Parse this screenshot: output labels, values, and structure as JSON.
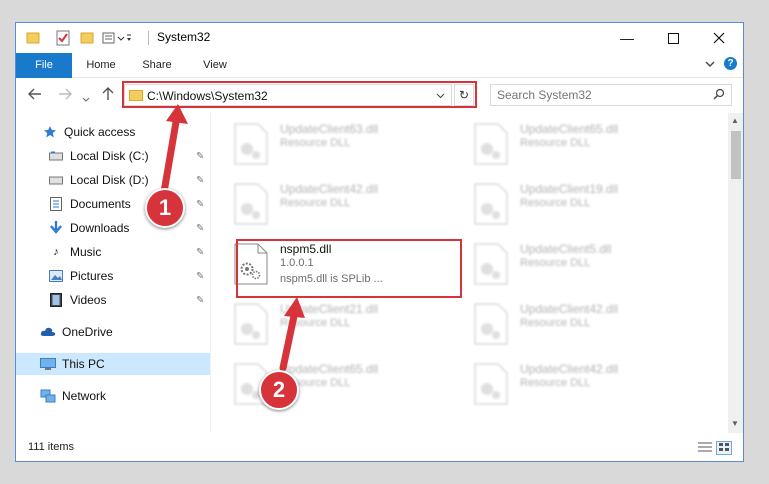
{
  "window": {
    "title": "System32"
  },
  "ribbon": {
    "tabs": [
      "File",
      "Home",
      "Share",
      "View"
    ]
  },
  "address": {
    "path": "C:\\Windows\\System32"
  },
  "search": {
    "placeholder": "Search System32"
  },
  "nav": {
    "items": [
      {
        "label": "Quick access",
        "icon": "star-icon",
        "pinned": false
      },
      {
        "label": "Local Disk (C:)",
        "icon": "drive-icon",
        "pinned": true
      },
      {
        "label": "Local Disk (D:)",
        "icon": "drive-icon",
        "pinned": true
      },
      {
        "label": "Documents",
        "icon": "document-icon",
        "pinned": true
      },
      {
        "label": "Downloads",
        "icon": "download-icon",
        "pinned": true
      },
      {
        "label": "Music",
        "icon": "music-icon",
        "pinned": true
      },
      {
        "label": "Pictures",
        "icon": "pictures-icon",
        "pinned": true
      },
      {
        "label": "Videos",
        "icon": "video-icon",
        "pinned": true
      },
      {
        "label": "OneDrive",
        "icon": "cloud-icon",
        "pinned": false
      },
      {
        "label": "This PC",
        "icon": "computer-icon",
        "pinned": false,
        "selected": true
      },
      {
        "label": "Network",
        "icon": "network-icon",
        "pinned": false
      }
    ]
  },
  "files": [
    {
      "name": "UpdateClient63.dll",
      "desc": "Resource DLL"
    },
    {
      "name": "UpdateClient65.dll",
      "desc": "Resource DLL"
    },
    {
      "name": "UpdateClient42.dll",
      "desc": "Resource DLL"
    },
    {
      "name": "UpdateClient19.dll",
      "desc": "Resource DLL"
    },
    {
      "name": "nspm5.dll",
      "version": "1.0.0.1",
      "desc": "nspm5.dll is SPLib ...",
      "highlighted": true
    },
    {
      "name": "UpdateClient5.dll",
      "desc": "Resource DLL"
    },
    {
      "name": "UpdateClient21.dll",
      "desc": "Resource DLL"
    },
    {
      "name": "UpdateClient42.dll",
      "desc": "Resource DLL"
    },
    {
      "name": "UpdateClient65.dll",
      "desc": "Resource DLL"
    },
    {
      "name": "UpdateClient42.dll",
      "desc": "Resource DLL"
    }
  ],
  "status": {
    "count": "111 items"
  },
  "annotations": {
    "step1": "1",
    "step2": "2"
  },
  "colors": {
    "accent": "#1979ca",
    "highlight": "#d7333b",
    "selected": "#cce8ff"
  }
}
